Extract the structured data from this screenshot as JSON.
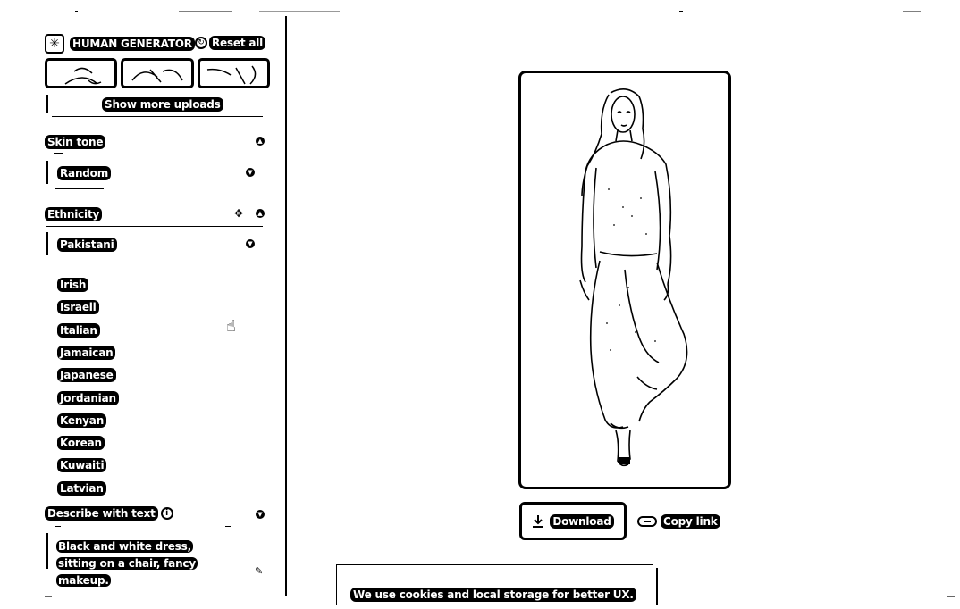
{
  "app": {
    "title": "HUMAN GENERATOR",
    "reset_label": "Reset all"
  },
  "uploads": {
    "show_more_label": "Show more uploads"
  },
  "skin_tone": {
    "label": "Skin tone",
    "value": "Random"
  },
  "ethnicity": {
    "label": "Ethnicity",
    "value": "Pakistani",
    "options": [
      "Irish",
      "Israeli",
      "Italian",
      "Jamaican",
      "Japanese",
      "Jordanian",
      "Kenyan",
      "Korean",
      "Kuwaiti",
      "Latvian"
    ]
  },
  "describe": {
    "label": "Describe with text",
    "prompt": "Black and white dress, sitting on a chair, fancy makeup."
  },
  "actions": {
    "download_label": "Download",
    "copy_link_label": "Copy link"
  },
  "cookie": {
    "text": "We use cookies and local storage for better UX."
  },
  "icons": {
    "logo": "snowflake-icon",
    "reset": "reset-icon",
    "collapse": "chevron-up-icon",
    "expand": "chevron-down-icon",
    "shuffle": "shuffle-icon",
    "info": "info-icon",
    "edit": "pencil-icon",
    "download": "download-icon",
    "link": "link-icon"
  }
}
